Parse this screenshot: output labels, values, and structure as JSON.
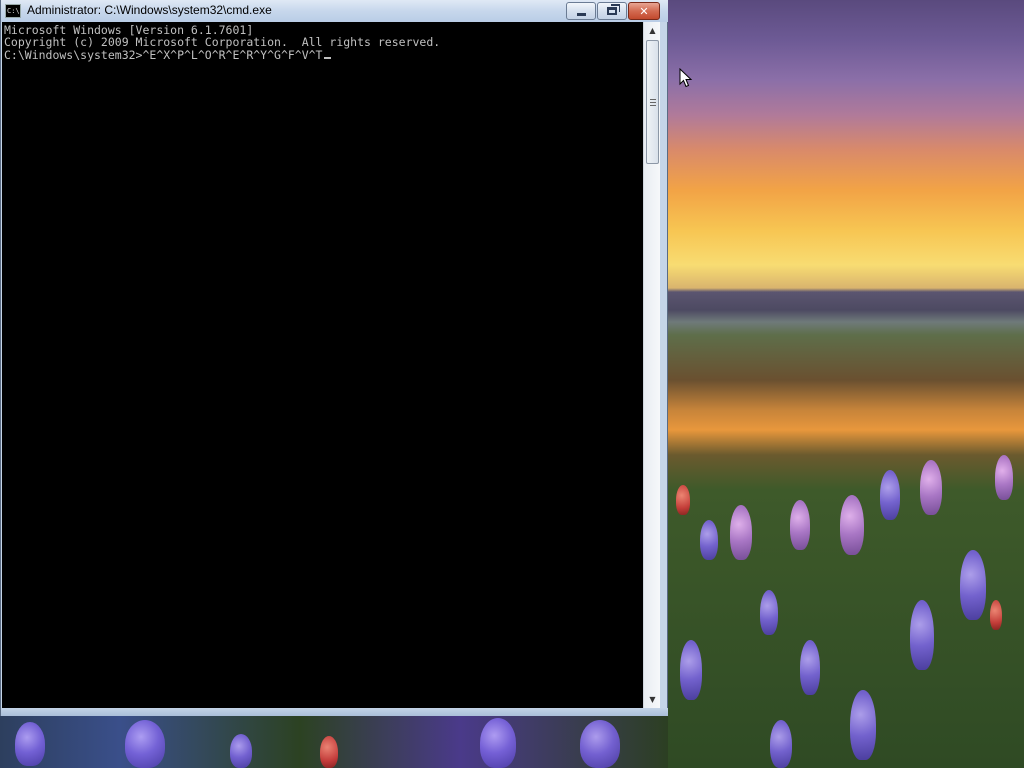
{
  "window": {
    "title": "Administrator: C:\\Windows\\system32\\cmd.exe",
    "icon_label": "C:\\",
    "buttons": {
      "minimize": "minimize-icon",
      "restore": "restore-icon",
      "close": "close-icon",
      "close_glyph": "✕"
    }
  },
  "console": {
    "lines": [
      "Microsoft Windows [Version 6.1.7601]",
      "Copyright (c) 2009 Microsoft Corporation.  All rights reserved.",
      "",
      "C:\\Windows\\system32>^E^X^P^L^O^R^E^R^Y^G^F^V^T"
    ]
  },
  "scrollbar": {
    "up_glyph": "▲",
    "down_glyph": "▼"
  },
  "colors": {
    "console_bg": "#000000",
    "console_text": "#c0c0c0",
    "close_button": "#c24a2e"
  }
}
